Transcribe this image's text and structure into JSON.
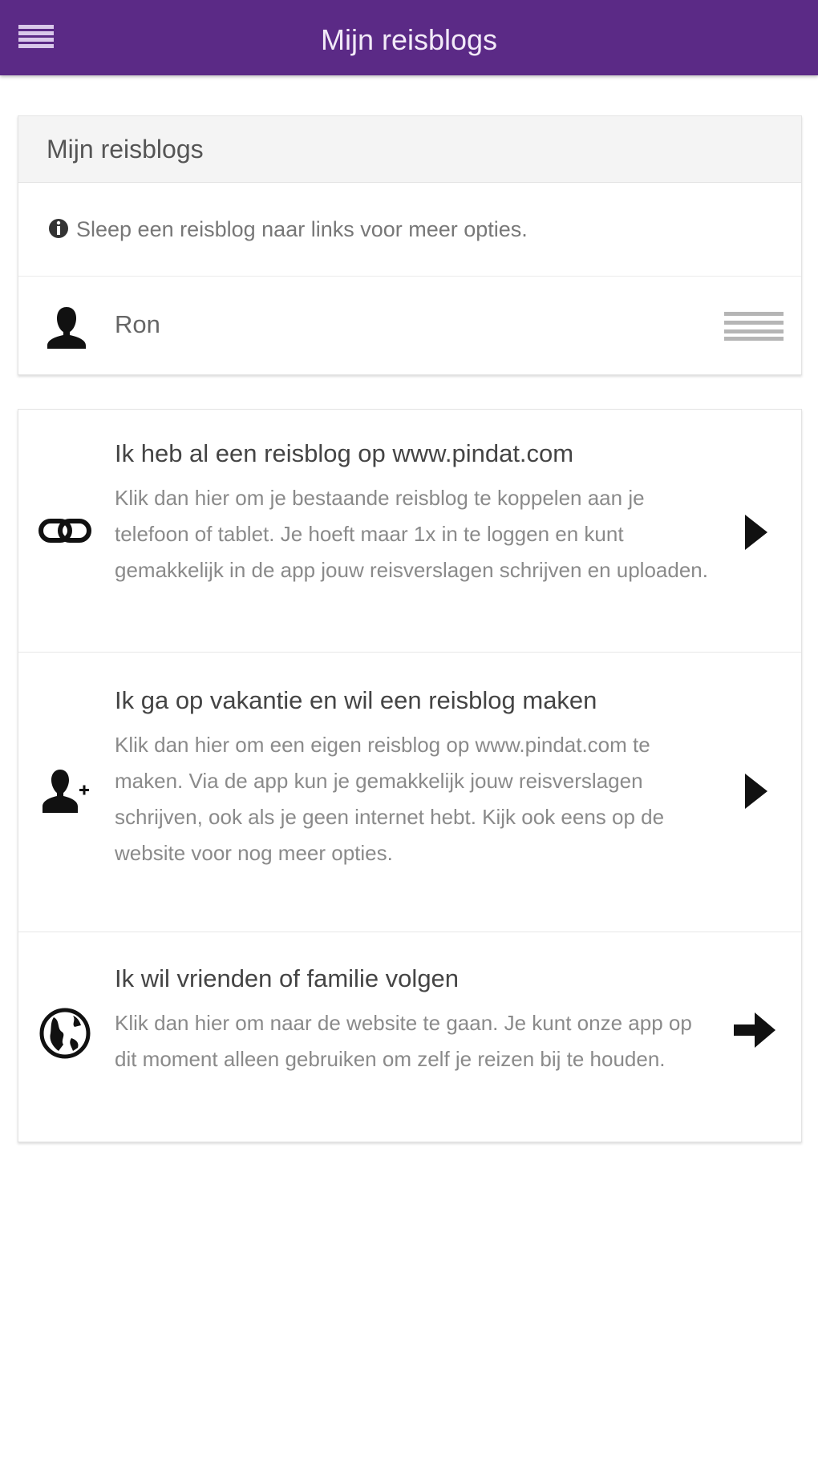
{
  "app_bar": {
    "title": "Mijn reisblogs",
    "menu_icon": "hamburger-menu-icon",
    "background": "#5b2a86"
  },
  "blogs_card": {
    "header": "Mijn reisblogs",
    "hint": "Sleep een reisblog naar links voor meer opties.",
    "hint_icon": "info-icon",
    "items": [
      {
        "name": "Ron",
        "icon": "user-icon",
        "handle_icon": "drag-handle-icon"
      }
    ]
  },
  "options": [
    {
      "title": "Ik heb al een reisblog op www.pindat.com",
      "description": "Klik dan hier om je bestaande reisblog te koppelen aan je telefoon of tablet. Je hoeft maar 1x in te loggen en kunt gemakkelijk in de app jouw reisverslagen schrijven en uploaden.",
      "icon": "link-icon",
      "arrow": "chevron-right-icon"
    },
    {
      "title": "Ik ga op vakantie en wil een reisblog maken",
      "description": "Klik dan hier om een eigen reisblog op www.pindat.com te maken. Via de app kun je gemakkelijk jouw reisverslagen schrijven, ook als je geen internet hebt. Kijk ook eens op de website voor nog meer opties.",
      "icon": "add-user-icon",
      "arrow": "chevron-right-icon"
    },
    {
      "title": "Ik wil vrienden of familie volgen",
      "description": "Klik dan hier om naar de website te gaan. Je kunt onze app op dit moment alleen gebruiken om zelf je reizen bij te houden.",
      "icon": "globe-icon",
      "arrow": "arrow-right-icon"
    }
  ]
}
